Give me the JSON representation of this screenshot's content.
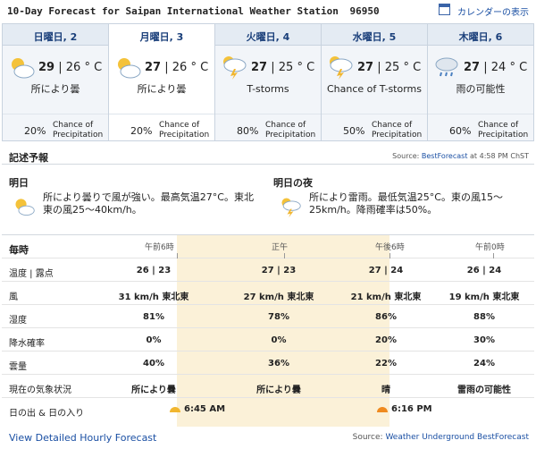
{
  "header": {
    "title": "10-Day Forecast for Saipan International Weather Station",
    "station_id": "96950",
    "calendar_link": "カレンダーの表示"
  },
  "days": [
    {
      "label": "日曜日, 2",
      "icon": "partly-cloudy-icon",
      "hi": "29",
      "lo": "26 ° C",
      "sep": "|",
      "condition": "所により曇",
      "precip_pct": "20%",
      "precip_label": "Chance of Precipitation"
    },
    {
      "label": "月曜日, 3",
      "icon": "partly-cloudy-icon",
      "hi": "27",
      "lo": "26 ° C",
      "sep": "|",
      "condition": "所により曇",
      "precip_pct": "20%",
      "precip_label": "Chance of Precipitation"
    },
    {
      "label": "火曜日, 4",
      "icon": "thunderstorm-icon",
      "hi": "27",
      "lo": "25 ° C",
      "sep": "|",
      "condition": "T-storms",
      "precip_pct": "80%",
      "precip_label": "Chance of Precipitation"
    },
    {
      "label": "水曜日, 5",
      "icon": "thunderstorm-icon",
      "hi": "27",
      "lo": "25 ° C",
      "sep": "|",
      "condition": "Chance of T-storms",
      "precip_pct": "50%",
      "precip_label": "Chance of Precipitation"
    },
    {
      "label": "木曜日, 6",
      "icon": "rain-icon",
      "hi": "27",
      "lo": "24 ° C",
      "sep": "|",
      "condition": "雨の可能性",
      "precip_pct": "60%",
      "precip_label": "Chance of Precipitation"
    }
  ],
  "summary": {
    "title": "記述予報",
    "source_prefix": "Source:",
    "source_name": "BestForecast",
    "source_suffix": "at 4:58 PM ChST",
    "tomorrow": {
      "title": "明日",
      "text": "所により曇りで風が強い。最高気温27°C。東北東の風25〜40km/h。"
    },
    "tomorrow_night": {
      "title": "明日の夜",
      "text": "所により雷雨。最低気温25°C。東の風15〜25km/h。降雨確率は50%。"
    }
  },
  "hourly": {
    "title": "毎時",
    "times": [
      "午前6時",
      "正午",
      "午後6時",
      "午前0時"
    ],
    "rows": [
      {
        "label": "温度 | 露点",
        "values": [
          "26 | 23",
          "27 | 23",
          "27 | 24",
          "26 | 24"
        ]
      },
      {
        "label": "風",
        "values": [
          "31 km/h 東北東",
          "27 km/h 東北東",
          "21 km/h 東北東",
          "19 km/h 東北東"
        ]
      },
      {
        "label": "湿度",
        "values": [
          "81%",
          "78%",
          "86%",
          "88%"
        ]
      },
      {
        "label": "降水確率",
        "values": [
          "0%",
          "0%",
          "20%",
          "30%"
        ]
      },
      {
        "label": "雲量",
        "values": [
          "40%",
          "36%",
          "22%",
          "24%"
        ]
      },
      {
        "label": "現在の気象状況",
        "values": [
          "所により曇",
          "所により曇",
          "晴",
          "雷雨の可能性"
        ]
      }
    ],
    "sun_label": "日の出 & 日の入り",
    "sunrise": "6:45 AM",
    "sunset": "6:16 PM"
  },
  "footer": {
    "link": "View Detailed Hourly Forecast",
    "source_prefix": "Source:",
    "source_name": "Weather Underground BestForecast"
  },
  "colors": {
    "link": "#1a4fa3",
    "highlight": "#fbf1d8",
    "sun": "#f1b62e"
  }
}
